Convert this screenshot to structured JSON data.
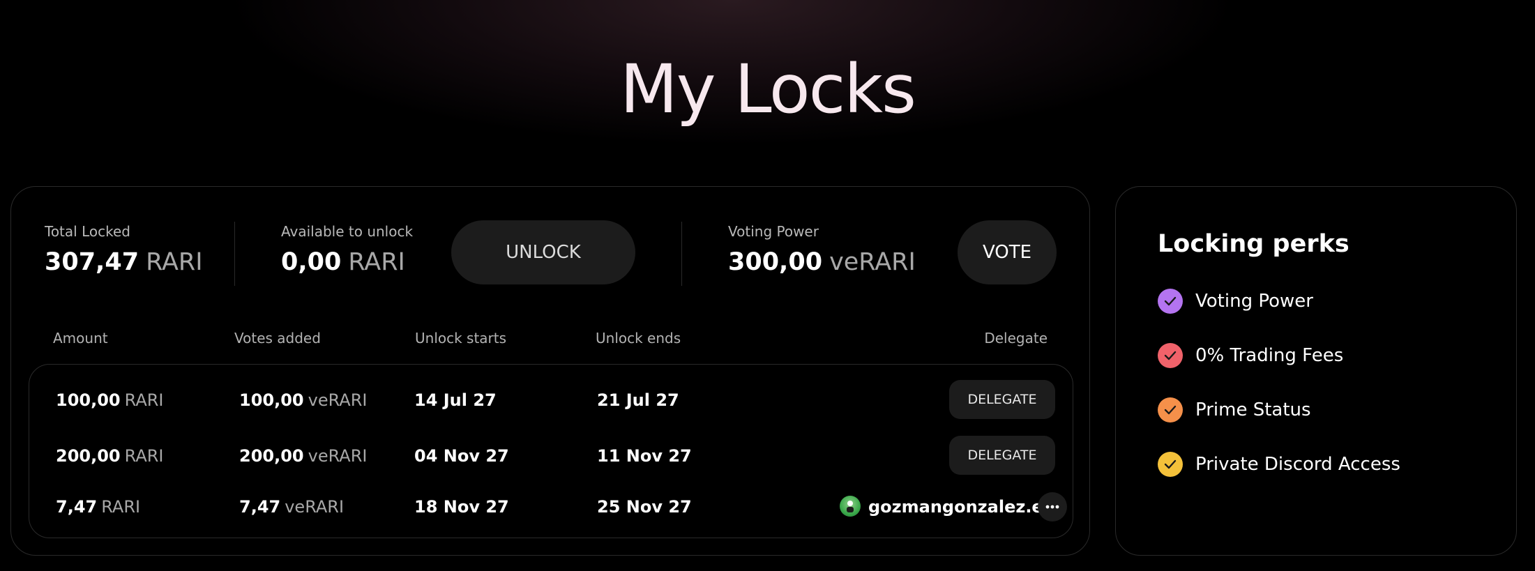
{
  "page": {
    "title": "My Locks"
  },
  "summary": {
    "total_locked": {
      "label": "Total Locked",
      "value": "307,47",
      "unit": "RARI"
    },
    "available": {
      "label": "Available to unlock",
      "value": "0,00",
      "unit": "RARI"
    },
    "unlock_button": "UNLOCK",
    "voting_power": {
      "label": "Voting Power",
      "value": "300,00",
      "unit": "veRARI"
    },
    "vote_button": "VOTE"
  },
  "table": {
    "headers": [
      "Amount",
      "Votes added",
      "Unlock starts",
      "Unlock ends",
      "Delegate"
    ],
    "rows": [
      {
        "amount": "100,00",
        "amount_unit": "RARI",
        "votes": "100,00",
        "votes_unit": "veRARI",
        "start": "14 Jul 27",
        "end": "21 Jul 27",
        "delegate_button": "DELEGATE"
      },
      {
        "amount": "200,00",
        "amount_unit": "RARI",
        "votes": "200,00",
        "votes_unit": "veRARI",
        "start": "04 Nov 27",
        "end": "11 Nov 27",
        "delegate_button": "DELEGATE"
      },
      {
        "amount": "7,47",
        "amount_unit": "RARI",
        "votes": "7,47",
        "votes_unit": "veRARI",
        "start": "18 Nov 27",
        "end": "25 Nov 27",
        "delegate_name": "gozmangonzalez.eth",
        "more_icon": "more-icon"
      }
    ]
  },
  "perks": {
    "title": "Locking perks",
    "items": [
      {
        "label": "Voting Power",
        "color": "#b474f0"
      },
      {
        "label": "0% Trading Fees",
        "color": "#f0626a"
      },
      {
        "label": "Prime Status",
        "color": "#f5904a"
      },
      {
        "label": "Private Discord Access",
        "color": "#f4c13a"
      }
    ]
  }
}
